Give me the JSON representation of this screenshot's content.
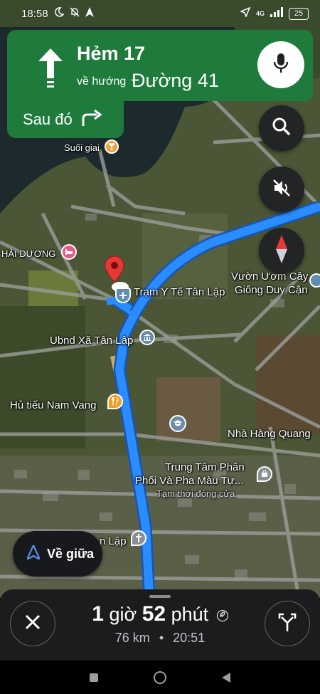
{
  "status_bar": {
    "time": "18:58",
    "network": "4G",
    "battery": "25"
  },
  "nav_card": {
    "street": "Hẻm 17",
    "toward_label": "về hướng",
    "toward_street": "Đường 41",
    "then_label": "Sau đó"
  },
  "map": {
    "labels": {
      "suoi_giai": "Suối giai",
      "hai_duong": "HẢI DƯƠNG",
      "tram_y_te": "Trạm Y Tế Tân Lập",
      "vuon_uom_1": "Vườn Ươm Cây",
      "vuon_uom_2": "Giống Duy Cận",
      "ubnd": "Ubnd Xã Tân Lập",
      "hu_tieu": "Hủ tiếu Nam Vang",
      "nha_hang": "Nhà Hàng Quang",
      "trung_tam_1": "Trung Tâm Phân",
      "trung_tam_2": "Phối Và Pha Màu Tự...",
      "tam_thoi": "Tạm thời đóng cửa",
      "lap": "n Lập"
    }
  },
  "recenter": {
    "label": "Về giữa"
  },
  "trip": {
    "hours": "1",
    "hours_unit": "giờ",
    "minutes": "52",
    "minutes_unit": "phút",
    "distance": "76 km",
    "separator": "•",
    "arrival": "20:51"
  },
  "colors": {
    "route": "#2b8cff",
    "nav_green": "#1e7b3c",
    "pin_red": "#e53935"
  },
  "icons": {
    "nav_arrow": "arrow-up-icon",
    "turn": "turn-right-icon",
    "mic": "mic-icon",
    "search": "search-icon",
    "mute": "volume-off-icon",
    "compass": "compass-icon",
    "recenter": "navigation-arrow-icon",
    "close": "close-icon",
    "routes": "alt-route-icon"
  }
}
